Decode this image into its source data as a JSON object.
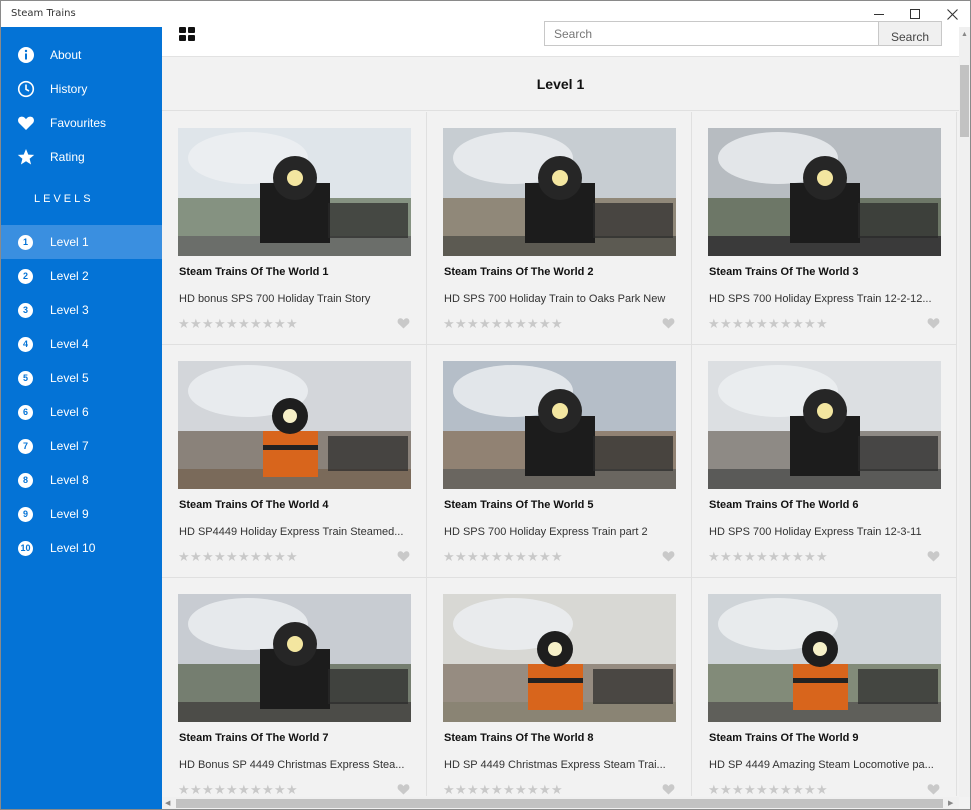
{
  "window": {
    "title": "Steam Trains"
  },
  "sidebar": {
    "menu": [
      {
        "label": "About",
        "icon": "info-icon"
      },
      {
        "label": "History",
        "icon": "clock-icon"
      },
      {
        "label": "Favourites",
        "icon": "heart-icon"
      },
      {
        "label": "Rating",
        "icon": "star-icon"
      }
    ],
    "levels_heading": "LEVELS",
    "levels": [
      {
        "num": "1",
        "label": "Level 1",
        "selected": true
      },
      {
        "num": "2",
        "label": "Level 2"
      },
      {
        "num": "3",
        "label": "Level 3"
      },
      {
        "num": "4",
        "label": "Level 4"
      },
      {
        "num": "5",
        "label": "Level 5"
      },
      {
        "num": "6",
        "label": "Level 6"
      },
      {
        "num": "7",
        "label": "Level 7"
      },
      {
        "num": "8",
        "label": "Level 8"
      },
      {
        "num": "9",
        "label": "Level 9"
      },
      {
        "num": "10",
        "label": "Level 10"
      }
    ]
  },
  "search": {
    "placeholder": "Search",
    "button_label": "Search"
  },
  "main": {
    "title": "Level 1"
  },
  "videos": [
    {
      "title": "Steam Trains Of The World 1",
      "desc": "HD bonus SPS 700 Holiday Train Story",
      "rating": 0
    },
    {
      "title": "Steam Trains Of The World 2",
      "desc": "HD SPS 700 Holiday Train to Oaks Park New",
      "rating": 0
    },
    {
      "title": "Steam Trains Of The World 3",
      "desc": "HD SPS 700 Holiday Express Train 12-2-12...",
      "rating": 0
    },
    {
      "title": "Steam Trains Of The World 4",
      "desc": "HD SP4449 Holiday Express Train Steamed...",
      "rating": 0
    },
    {
      "title": "Steam Trains Of The World 5",
      "desc": "HD SPS 700 Holiday Express Train part 2",
      "rating": 0
    },
    {
      "title": "Steam Trains Of The World 6",
      "desc": "HD SPS 700 Holiday Express Train 12-3-11",
      "rating": 0
    },
    {
      "title": "Steam Trains Of The World 7",
      "desc": "HD Bonus SP 4449 Christmas Express Stea...",
      "rating": 0
    },
    {
      "title": "Steam Trains Of The World 8",
      "desc": "HD SP 4449 Christmas Express Steam Trai...",
      "rating": 0
    },
    {
      "title": "Steam Trains Of The World 9",
      "desc": "HD SP 4449 Amazing Steam Locomotive pa...",
      "rating": 0
    }
  ],
  "colors": {
    "sidebar": "#0473d6",
    "selected": "#3a8fe0",
    "background": "#f2f2f2"
  }
}
